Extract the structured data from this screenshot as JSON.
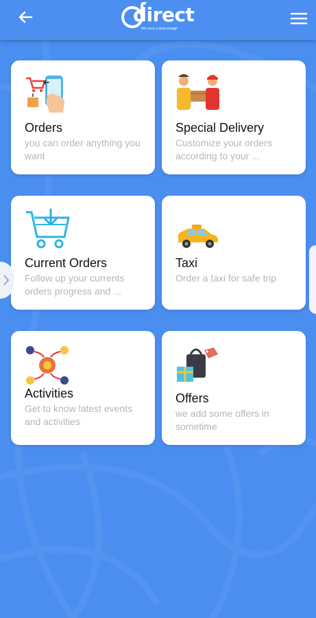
{
  "header": {
    "logo_text": "direct",
    "logo_tagline": "We carry a long enough",
    "back_icon": "arrow-left-icon",
    "menu_icon": "hamburger-menu-icon"
  },
  "cards": [
    {
      "title": "Orders",
      "desc": "you can order anything you want",
      "icon": "orders-icon"
    },
    {
      "title": "Special Delivery",
      "desc": "Customize your orders according to your ...",
      "icon": "special-delivery-icon"
    },
    {
      "title": "Current Orders",
      "desc": "Follow up your currents orders progress and ...",
      "icon": "shopping-cart-icon"
    },
    {
      "title": "Taxi",
      "desc": "Order a taxi for safe trip",
      "icon": "taxi-icon"
    },
    {
      "title": "Activities",
      "desc": "Get to know latest events and activities",
      "icon": "activities-icon"
    },
    {
      "title": "Offers",
      "desc": "we add some offers in sometime",
      "icon": "offers-icon"
    }
  ],
  "colors": {
    "background": "#4a8ef0",
    "card": "#ffffff",
    "title": "#111111",
    "description": "#b6b6b6"
  }
}
